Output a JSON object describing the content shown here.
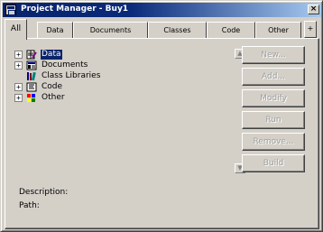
{
  "window": {
    "title": "Project Manager - Buy1"
  },
  "tabs": [
    {
      "label": "All",
      "active": true
    },
    {
      "label": "Data"
    },
    {
      "label": "Documents"
    },
    {
      "label": "Classes"
    },
    {
      "label": "Code"
    },
    {
      "label": "Other"
    }
  ],
  "tab_scroll_symbol": "+",
  "tree": {
    "items": [
      {
        "label": "Data",
        "expander": "+",
        "icon": "data-icon",
        "selected": true
      },
      {
        "label": "Documents",
        "expander": "+",
        "icon": "documents-icon"
      },
      {
        "label": "Class Libraries",
        "expander": "",
        "icon": "class-libraries-icon"
      },
      {
        "label": "Code",
        "expander": "+",
        "icon": "code-icon"
      },
      {
        "label": "Other",
        "expander": "+",
        "icon": "other-icon"
      }
    ]
  },
  "buttons": {
    "new": "New...",
    "add": "Add...",
    "modify": "Modify",
    "run": "Run",
    "remove": "Remove...",
    "build": "Build"
  },
  "info": {
    "description_label": "Description:",
    "path_label": "Path:"
  },
  "colors": {
    "titlebar_start": "#08246b",
    "titlebar_end": "#a6caf0",
    "selection": "#0a246a",
    "face": "#d4d0c8"
  }
}
